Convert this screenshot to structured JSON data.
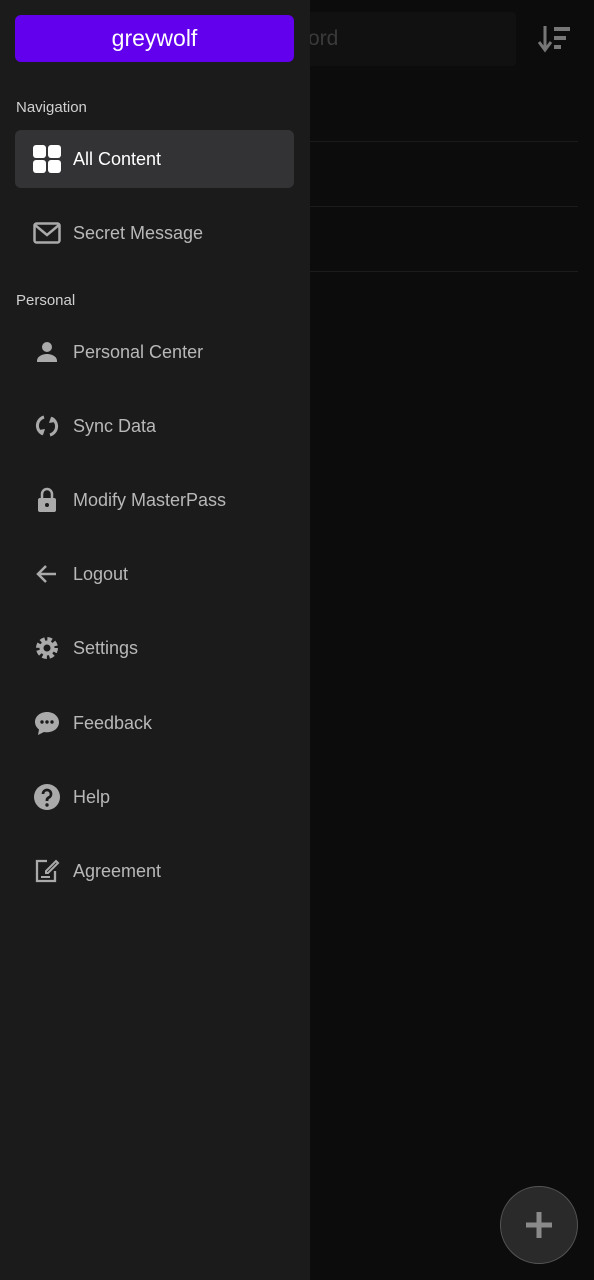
{
  "background": {
    "search_placeholder_visible": "ord",
    "sort_icon": "sort-descending-icon",
    "fab_icon": "plus-icon"
  },
  "drawer": {
    "username": "greywolf",
    "accent": "#6200ee",
    "navigation_header": "Navigation",
    "personal_header": "Personal",
    "navigation": [
      {
        "label": "All Content",
        "icon": "grid-icon",
        "active": true
      },
      {
        "label": "Secret Message",
        "icon": "mail-icon"
      }
    ],
    "personal": [
      {
        "label": "Personal Center",
        "icon": "person-icon"
      },
      {
        "label": "Sync Data",
        "icon": "sync-icon"
      },
      {
        "label": "Modify MasterPass",
        "icon": "lock-icon"
      },
      {
        "label": "Logout",
        "icon": "arrow-left-icon"
      },
      {
        "label": "Settings",
        "icon": "gear-icon"
      },
      {
        "label": "Feedback",
        "icon": "feedback-icon"
      },
      {
        "label": "Help",
        "icon": "help-icon"
      },
      {
        "label": "Agreement",
        "icon": "edit-document-icon"
      }
    ]
  }
}
